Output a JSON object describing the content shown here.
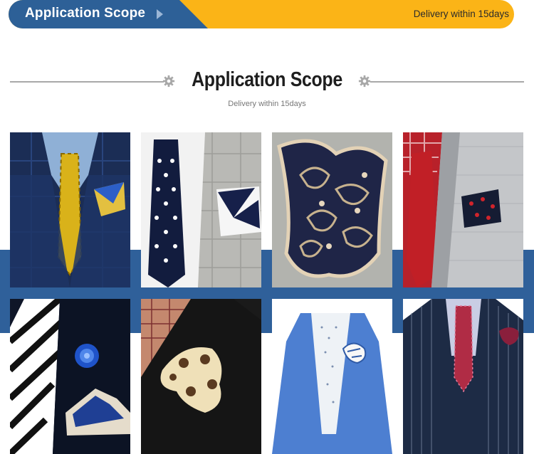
{
  "banner": {
    "title": "Application Scope",
    "note": "Delivery within 15days",
    "tab_color": "#2d6097",
    "accent_color": "#fbb417"
  },
  "heading": {
    "title": "Application Scope",
    "subtitle": "Delivery within 15days",
    "icon": "gear-icon"
  },
  "band_color": "#2f609a",
  "gallery": [
    "navy plaid suit with yellow paisley tie and blue pocket square",
    "grey plaid jacket with navy polka dot tie and white-navy pocket square",
    "navy paisley pocket square folded puff",
    "light grey jacket with red gingham shirt and dotted pocket square",
    "black suit with striped tie and blue rose pocket square",
    "black jacket with plaid shirt and cream dotted pocket square",
    "light blue linen jacket with printed shirt and white pocket square",
    "navy pinstripe three-piece suit with red paisley tie"
  ]
}
